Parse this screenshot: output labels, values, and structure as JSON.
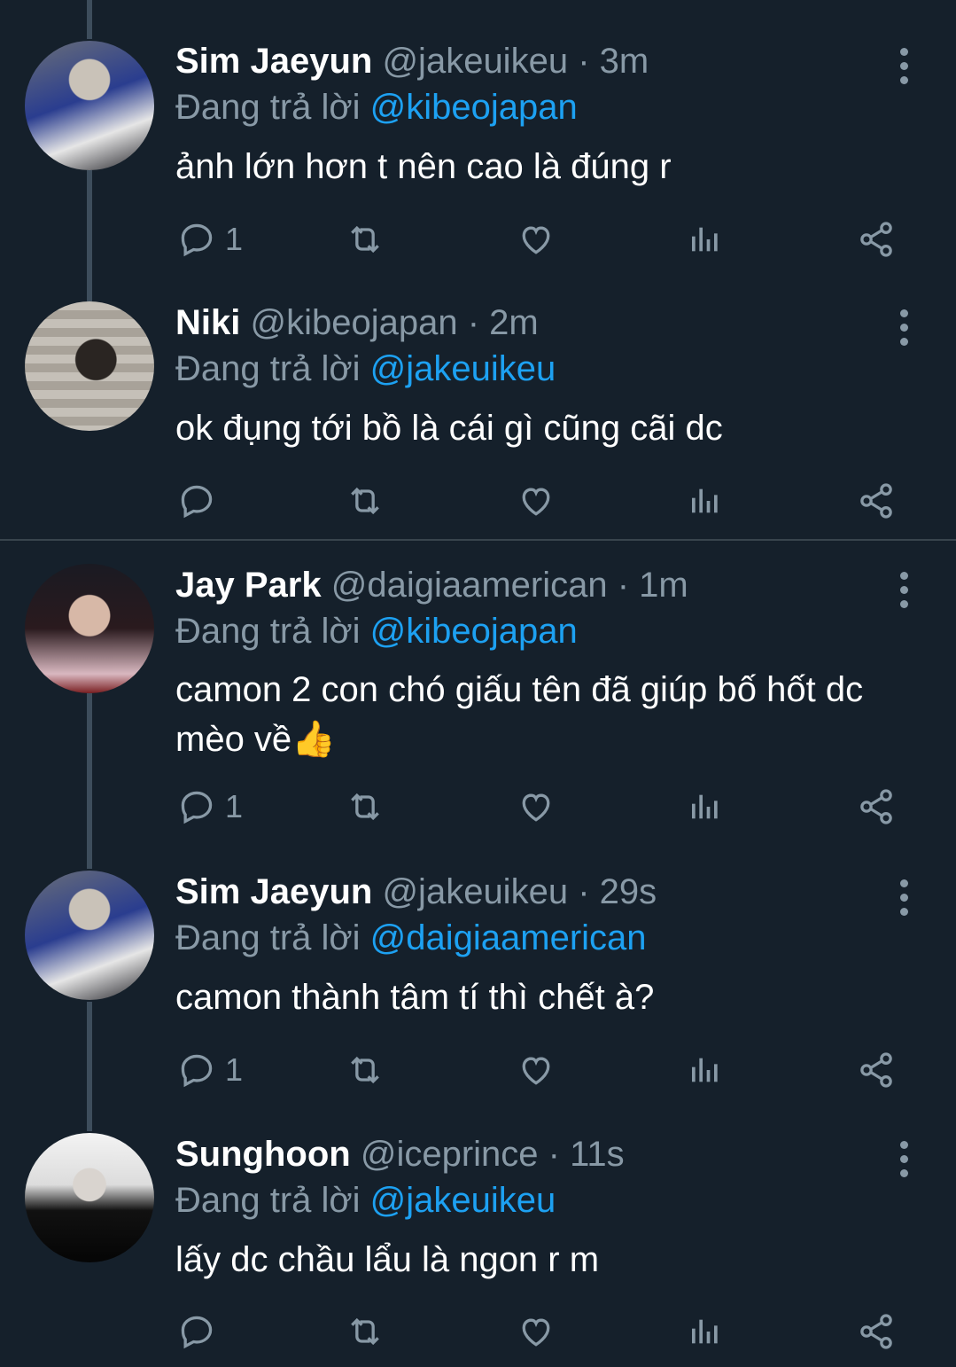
{
  "tweets": [
    {
      "name": "Sim Jaeyun",
      "handle": "@jakeuikeu",
      "time": "· 3m",
      "reply_prefix": "Đang trả lời",
      "reply_to": "@kibeojapan",
      "text": "ảnh lớn hơn t nên cao là đúng r",
      "reply_count": "1"
    },
    {
      "name": "Niki",
      "handle": "@kibeojapan",
      "time": "· 2m",
      "reply_prefix": "Đang trả lời",
      "reply_to": "@jakeuikeu",
      "text": "ok đụng tới bồ là cái gì cũng cãi dc",
      "reply_count": ""
    },
    {
      "name": "Jay Park",
      "handle": "@daigiaamerican",
      "time": "· 1m",
      "reply_prefix": "Đang trả lời",
      "reply_to": "@kibeojapan",
      "text": "camon 2 con chó giấu tên đã giúp bố hốt dc mèo về👍",
      "reply_count": "1"
    },
    {
      "name": "Sim Jaeyun",
      "handle": "@jakeuikeu",
      "time": "· 29s",
      "reply_prefix": "Đang trả lời",
      "reply_to": "@daigiaamerican",
      "text": "camon thành tâm tí thì chết à?",
      "reply_count": "1"
    },
    {
      "name": "Sunghoon",
      "handle": "@iceprince",
      "time": "· 11s",
      "reply_prefix": "Đang trả lời",
      "reply_to": "@jakeuikeu",
      "text": "lấy dc chầu lẩu là ngon r m",
      "reply_count": ""
    }
  ],
  "icons": {
    "reply": "reply-icon",
    "retweet": "retweet-icon",
    "like": "heart-icon",
    "analytics": "analytics-icon",
    "share": "share-icon",
    "more": "more-vertical-icon"
  },
  "colors": {
    "background": "#15202b",
    "text": "#ffffff",
    "muted": "#8899a6",
    "link": "#1da1f2",
    "thread_line": "#3d4d5c"
  }
}
